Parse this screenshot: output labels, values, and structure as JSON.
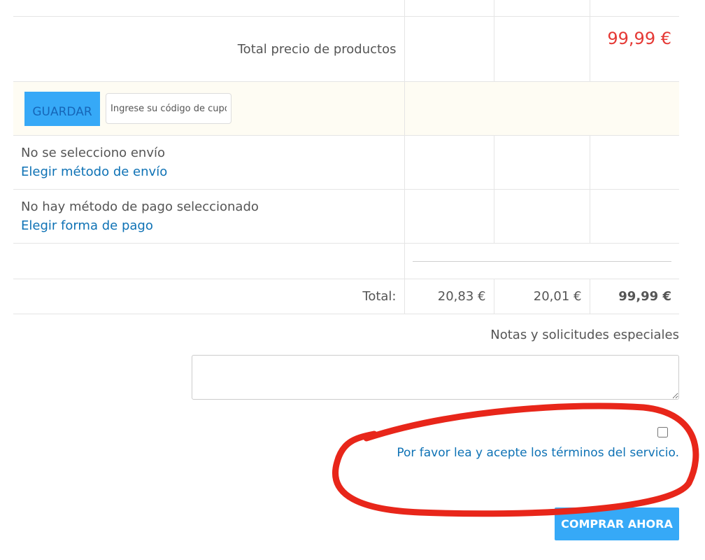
{
  "cart": {
    "subtotal_label": "Total precio de productos",
    "subtotal_value": "99,99 €",
    "coupon": {
      "save_label": "GUARDAR",
      "placeholder": "Ingrese su código de cupón",
      "value": ""
    },
    "shipping": {
      "status": "No se selecciono envío",
      "link": "Elegir método de envío"
    },
    "payment": {
      "status": "No hay método de pago seleccionado",
      "link": "Elegir forma de pago"
    },
    "totals": {
      "label": "Total:",
      "net": "20,83 €",
      "tax": "20,01 €",
      "grand": "99,99 €"
    }
  },
  "notes": {
    "label": "Notas y solicitudes especiales",
    "value": ""
  },
  "terms": {
    "checked": false,
    "link": "Por favor lea y acepte los términos del servicio."
  },
  "checkout": {
    "button_label": "COMPRAR AHORA"
  },
  "colors": {
    "accent": "#36a9f7",
    "link": "#0e72b5",
    "price": "#e53935",
    "annotation": "#e8261a"
  }
}
